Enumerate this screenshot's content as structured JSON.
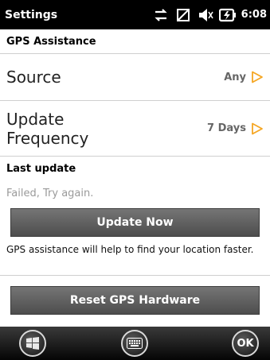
{
  "statusbar": {
    "title": "Settings",
    "time": "6:08"
  },
  "section1": {
    "title": "GPS Assistance"
  },
  "source": {
    "label": "Source",
    "value": "Any"
  },
  "frequency": {
    "label_line1": "Update",
    "label_line2": "Frequency",
    "value": "7 Days"
  },
  "section2": {
    "title": "Last update"
  },
  "status": {
    "text": "Failed, Try again."
  },
  "buttons": {
    "update": "Update Now",
    "reset": "Reset GPS Hardware"
  },
  "help": {
    "text": "GPS assistance will help to find your location faster."
  },
  "softkeys": {
    "ok": "OK"
  },
  "colors": {
    "accent": "#f5a623"
  },
  "icons": [
    "data-sync-icon",
    "no-signal-icon",
    "volume-muted-icon",
    "battery-charging-icon",
    "windows-start-icon",
    "keyboard-icon"
  ]
}
